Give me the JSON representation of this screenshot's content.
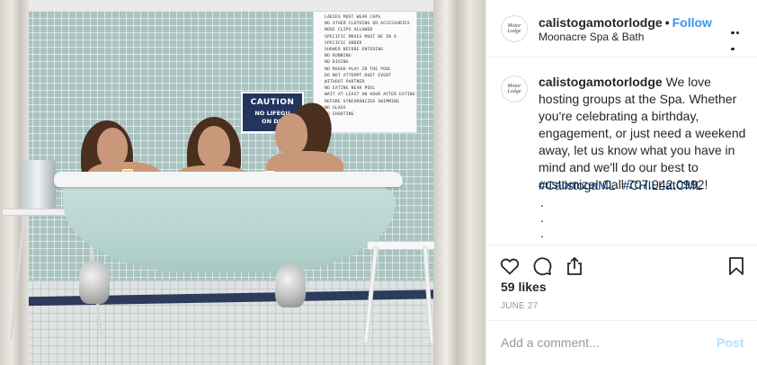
{
  "photo": {
    "rules_sign_lines": [
      "LADIES MUST WEAR CAPS",
      "NO OTHER CLOTHING OR ACCESSORIES",
      "NOSE CLIPS ALLOWED",
      "SPECIFIC MOVES MUST BE IN A",
      "SPECIFIC ORDER",
      "SHOWER BEFORE ENTERING",
      "NO RUNNING",
      "NO DIVING",
      "NO ROUGH PLAY IN THE POOL",
      "DO NOT ATTEMPT DUET EVENT",
      "WITHOUT PARTNER",
      "NO EATING NEAR POOL",
      "WAIT AT LEAST AN HOUR AFTER EATING",
      "BEFORE SYNCHRONIZED SWIMMING",
      "NO GLASS",
      "NO SHOOTING"
    ],
    "caution_title": "CAUTION",
    "caution_line1": "NO LIFEGU",
    "caution_line2": "ON DU"
  },
  "header": {
    "avatar_text": "Motor Lodge",
    "username": "calistogamotorlodge",
    "separator": "•",
    "follow_label": "Follow",
    "location": "Moonacre Spa & Bath",
    "more_icon": "more-options-icon"
  },
  "caption": {
    "avatar_text": "Motor Lodge",
    "username": "calistogamotorlodge",
    "text": " We love hosting groups at the Spa. Whether you're celebrating a birthday, engagement, or just need a weekend away, let us know what you have in mind and we'll do our best to customize! Call 707.942.0992!",
    "hashtags": [
      "#CalistogaML",
      "#CHILLatCML"
    ],
    "dots": [
      ".",
      ".",
      "."
    ]
  },
  "actions": {
    "like_icon": "heart-icon",
    "comment_icon": "comment-icon",
    "share_icon": "share-icon",
    "save_icon": "bookmark-icon"
  },
  "likes": "59 likes",
  "date": "JUNE 27",
  "comment": {
    "placeholder": "Add a comment...",
    "value": "",
    "post_label": "Post"
  },
  "colors": {
    "accent": "#3897f0",
    "hashtag": "#003569",
    "post_disabled": "#b2dffc"
  }
}
